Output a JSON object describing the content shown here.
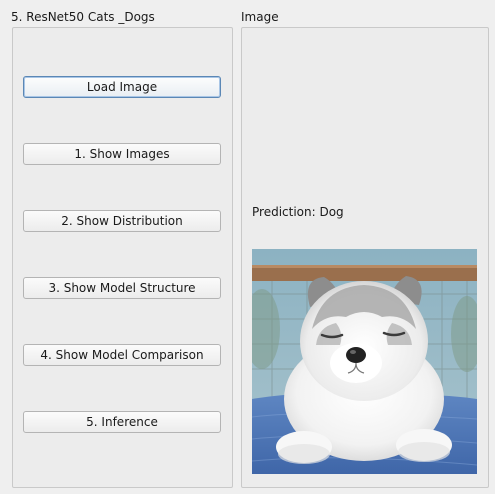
{
  "window": {
    "left_group_title": "5. ResNet50 Cats _Dogs",
    "right_group_title": "Image"
  },
  "buttons": [
    {
      "label": "Load Image"
    },
    {
      "label": "1. Show Images"
    },
    {
      "label": "2. Show Distribution"
    },
    {
      "label": "3. Show Model Structure"
    },
    {
      "label": "4. Show Model Comparison"
    },
    {
      "label": "5. Inference"
    }
  ],
  "result": {
    "prediction_text": "Prediction: Dog"
  },
  "image": {
    "subject": "puppy-photo"
  },
  "colors": {
    "window_bg": "#efefef",
    "focus_border": "#5b87b5"
  }
}
